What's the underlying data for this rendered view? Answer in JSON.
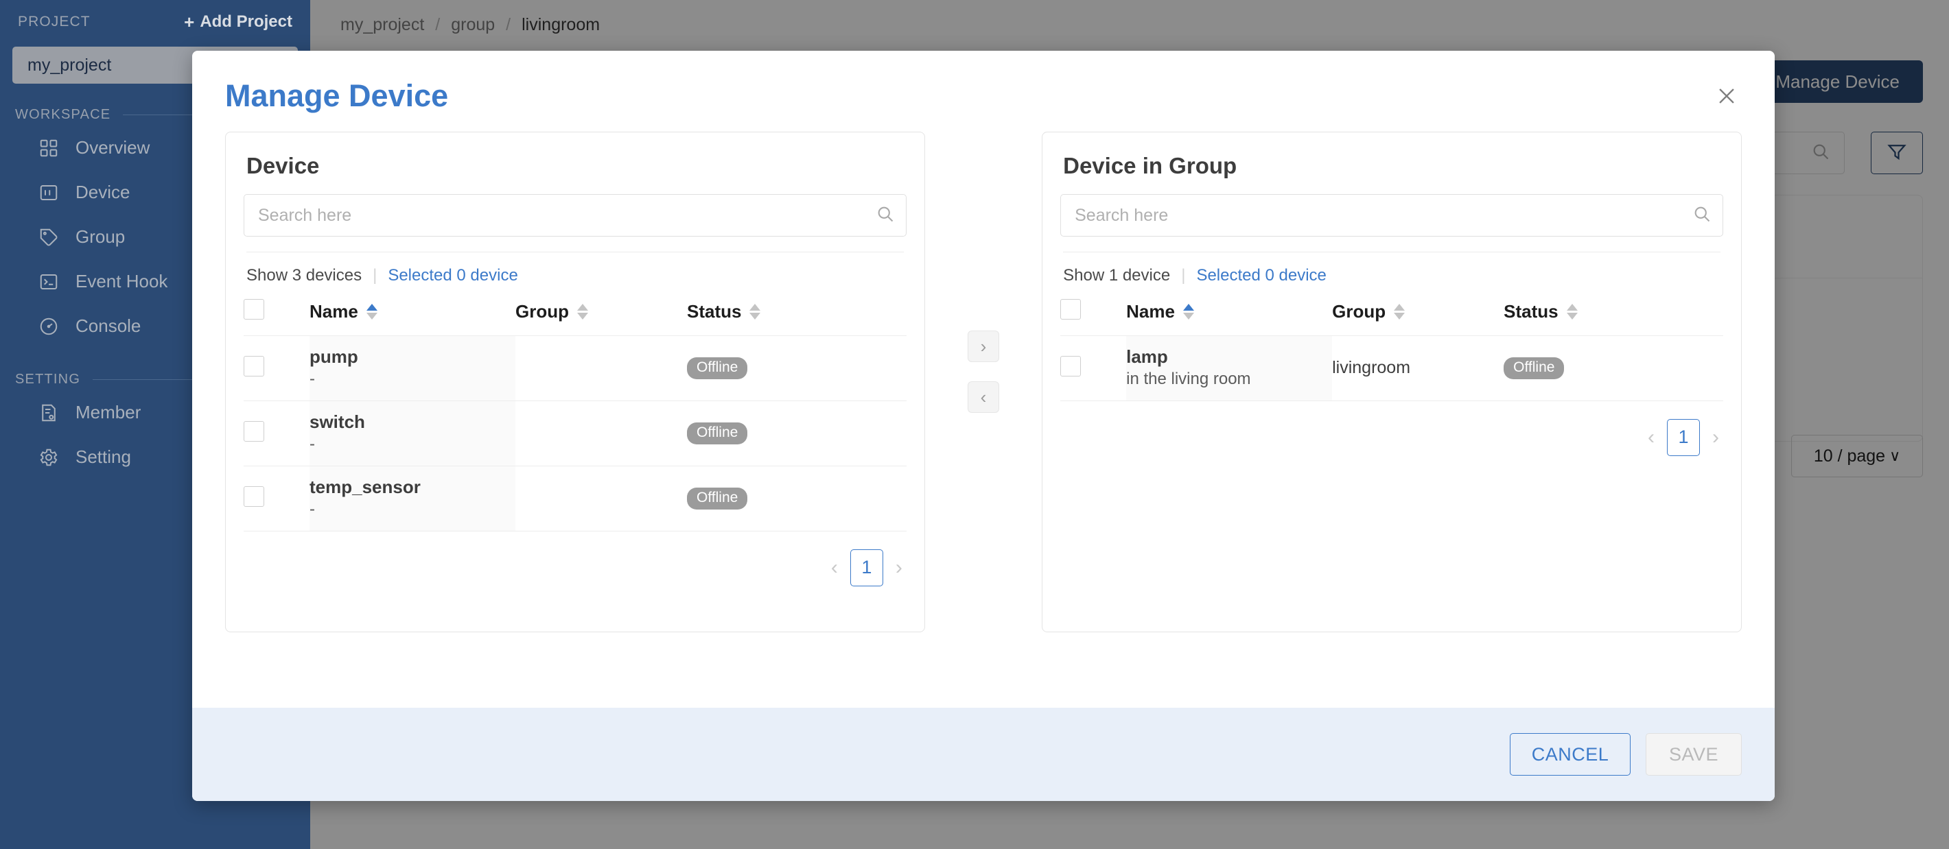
{
  "sidebar": {
    "project_label": "PROJECT",
    "add_project_label": "Add Project",
    "current_project": "my_project",
    "workspace_label": "WORKSPACE",
    "setting_label": "SETTING",
    "workspace_items": [
      {
        "label": "Overview",
        "icon": "grid-icon"
      },
      {
        "label": "Device",
        "icon": "device-icon"
      },
      {
        "label": "Group",
        "icon": "tag-icon"
      },
      {
        "label": "Event Hook",
        "icon": "terminal-icon"
      },
      {
        "label": "Console",
        "icon": "gauge-icon"
      }
    ],
    "setting_items": [
      {
        "label": "Member",
        "icon": "member-icon"
      },
      {
        "label": "Setting",
        "icon": "gear-icon"
      }
    ]
  },
  "topbar": {
    "breadcrumb": [
      "my_project",
      "group",
      "livingroom"
    ],
    "separator": "/"
  },
  "background": {
    "manage_device_button": "Manage Device",
    "search_placeholder": "",
    "per_page": "10 / page",
    "per_page_caret": "∨"
  },
  "modal": {
    "title": "Manage Device",
    "close_icon": "×",
    "left_panel": {
      "title": "Device",
      "search_placeholder": "Search here",
      "search_value": "",
      "show_count_text": "Show 3 devices",
      "selected_text": "Selected 0 device",
      "columns": [
        "Name",
        "Group",
        "Status"
      ],
      "rows": [
        {
          "name": "pump",
          "sub": "-",
          "group": "",
          "status": "Offline"
        },
        {
          "name": "switch",
          "sub": "-",
          "group": "",
          "status": "Offline"
        },
        {
          "name": "temp_sensor",
          "sub": "-",
          "group": "",
          "status": "Offline"
        }
      ],
      "pagination": {
        "prev": "‹",
        "page": "1",
        "next": "›"
      }
    },
    "transfer": {
      "to_right": "›",
      "to_left": "‹"
    },
    "right_panel": {
      "title": "Device in Group",
      "search_placeholder": "Search here",
      "search_value": "",
      "show_count_text": "Show 1 device",
      "selected_text": "Selected 0 device",
      "columns": [
        "Name",
        "Group",
        "Status"
      ],
      "rows": [
        {
          "name": "lamp",
          "sub": "in the living room",
          "group": "livingroom",
          "status": "Offline"
        }
      ],
      "pagination": {
        "prev": "‹",
        "page": "1",
        "next": "›"
      }
    },
    "footer": {
      "cancel": "CANCEL",
      "save": "SAVE"
    }
  },
  "colors": {
    "sidebar_bg": "#2b4a74",
    "accent_blue": "#3c7ac9",
    "footer_bg": "#e8eff9",
    "offline_badge": "#9b9b9b"
  }
}
